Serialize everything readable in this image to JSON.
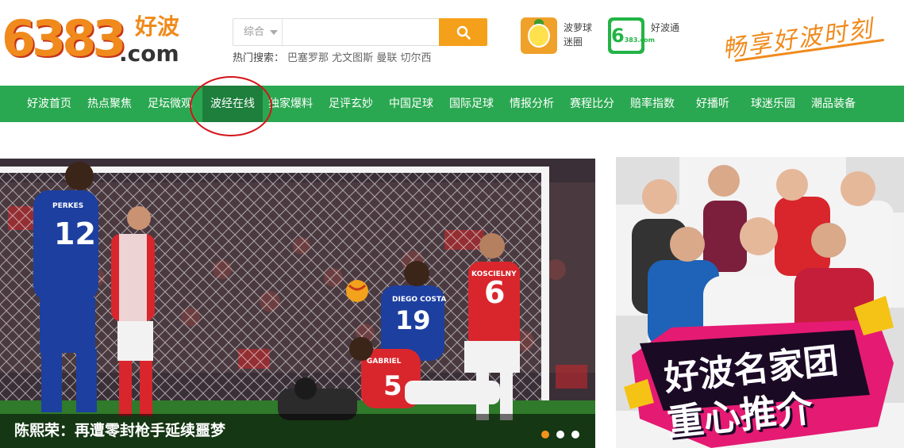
{
  "header": {
    "logo_number": "6383",
    "logo_cn": "好波",
    "logo_com": ".com",
    "search": {
      "category": "综合",
      "value": "",
      "placeholder": ""
    },
    "hot_label": "热门搜索：",
    "hot_terms": [
      "巴塞罗那",
      "尤文图斯",
      "曼联",
      "切尔西"
    ],
    "apps": [
      {
        "label_line1": "波萝球",
        "label_line2": "迷圈",
        "icon": "pineapple-mascot-icon"
      },
      {
        "label_line1": "好波通",
        "label_line2": "",
        "icon": "app-6383-icon"
      }
    ],
    "app2_badge_big": "6",
    "app2_badge_small": "383.com",
    "slogan": "畅享好波时刻"
  },
  "nav": {
    "items": [
      "好波首页",
      "热点聚焦",
      "足坛微观",
      "波经在线",
      "独家爆料",
      "足评玄妙",
      "中国足球",
      "国际足球",
      "情报分析",
      "赛程比分",
      "赔率指数",
      "好播听",
      "球迷乐园",
      "潮品装备"
    ],
    "active_index": 3
  },
  "hero": {
    "caption": "陈熙荣：再遭零封枪手延续噩梦",
    "slide_count": 3,
    "active_slide": 0,
    "jersey_texts": [
      "12",
      "6",
      "5",
      "19",
      "DIEGO COSTA",
      "KOSCIELNY",
      "GABRIEL",
      "PERKES"
    ]
  },
  "ad": {
    "title_line1": "好波名家团",
    "title_line2": "重心推介"
  },
  "colors": {
    "nav_green": "#2aa851",
    "nav_active": "#1e7e3c",
    "brand_orange": "#f08a1c",
    "search_button": "#f5a01a",
    "annotation_red": "#d4141a"
  }
}
